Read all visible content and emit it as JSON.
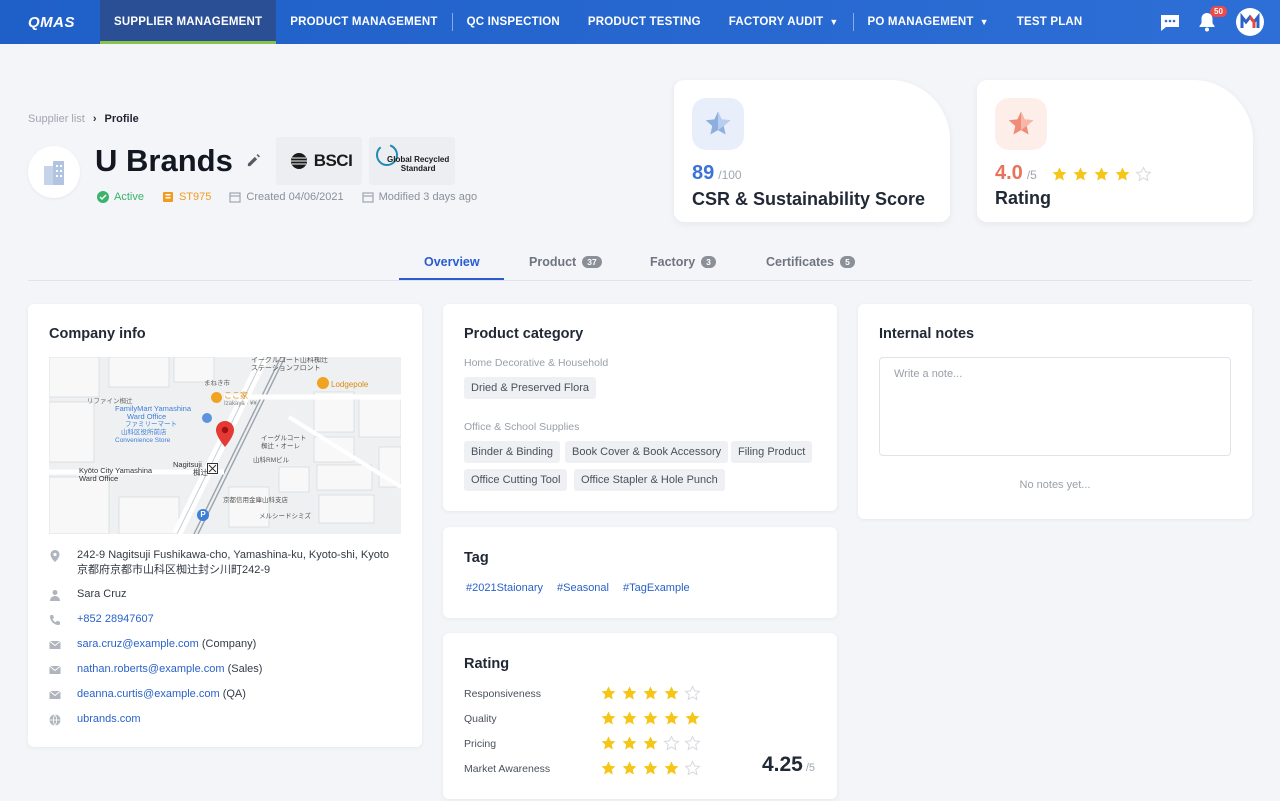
{
  "app": {
    "logo": "QMAS"
  },
  "nav": {
    "items": [
      {
        "label": "SUPPLIER MANAGEMENT"
      },
      {
        "label": "PRODUCT MANAGEMENT"
      },
      {
        "label": "QC INSPECTION"
      },
      {
        "label": "PRODUCT TESTING"
      },
      {
        "label": "FACTORY AUDIT"
      },
      {
        "label": "PO MANAGEMENT"
      },
      {
        "label": "TEST PLAN"
      }
    ],
    "notification_count": "50",
    "colors": {
      "bar": "#2d6fd6",
      "active": "#2b4f94",
      "active_underline": "#8bc34a"
    }
  },
  "breadcrumb": {
    "parent": "Supplier list",
    "current": "Profile"
  },
  "supplier": {
    "name": "U Brands",
    "status": "Active",
    "code": "ST975",
    "created": "Created 04/06/2021",
    "modified": "Modified 3 days ago",
    "certs": [
      {
        "name": "BSCI",
        "text": "BSCI"
      },
      {
        "name": "global-recycled-standard",
        "line1": "Global Recycled",
        "line2": "Standard"
      }
    ]
  },
  "scores": {
    "csr": {
      "value": "89",
      "max": "/100",
      "label": "CSR & Sustainability Score"
    },
    "rating": {
      "value": "4.0",
      "max": "/5",
      "label": "Rating",
      "stars": 4
    }
  },
  "tabs": [
    {
      "label": "Overview",
      "count": ""
    },
    {
      "label": "Product",
      "count": "37"
    },
    {
      "label": "Factory",
      "count": "3"
    },
    {
      "label": "Certificates",
      "count": "5"
    }
  ],
  "company_info": {
    "title": "Company info",
    "map": {
      "labels": {
        "top": "イーグルコート山科椥辻",
        "top2": "ステーションフロント",
        "lodgepole": "Lodgepole",
        "familymart": "FamilyMart Yamashina",
        "ward_office": "Ward Office",
        "jp_familymart": "ファミリーマート",
        "jp_ward": "山科区役所前店",
        "convenience": "Convenience Store",
        "kokoya": "ここ家",
        "izakaya": "Izakaya · ¥¥",
        "kyoto_city": "Kyōto City Yamashina",
        "kyoto_ward": "Ward Office",
        "nagitsuji": "Nagitsuji",
        "nagitsuji_jp": "椥辻",
        "eagle": "イーグルコート",
        "eagle2": "椥辻・オーレ",
        "building": "山科RMビル",
        "bank": "京都信用金庫山科支店",
        "mercedes": "メルシードシミズ",
        "rifine": "リファイン椥辻",
        "manezuki": "まねき市"
      }
    },
    "address_en": "242-9 Nagitsuji Fushikawa-cho, Yamashina-ku, Kyoto-shi, Kyoto",
    "address_jp": "京都府京都市山科区椥辻封シ川町242-9",
    "contact": "Sara Cruz",
    "phone": "+852 28947607",
    "emails": [
      {
        "email": "sara.cruz@example.com",
        "role": "(Company)"
      },
      {
        "email": "nathan.roberts@example.com",
        "role": "(Sales)"
      },
      {
        "email": "deanna.curtis@example.com",
        "role": "(QA)"
      }
    ],
    "website": "ubrands.com"
  },
  "product_category": {
    "title": "Product category",
    "groups": [
      {
        "name": "Home Decorative & Household",
        "items": [
          "Dried & Preserved Flora"
        ]
      },
      {
        "name": "Office & School Supplies",
        "items": [
          "Binder & Binding",
          "Book Cover & Book Accessory",
          "Filing Product",
          "Office Cutting Tool",
          "Office Stapler & Hole Punch"
        ]
      }
    ]
  },
  "tag": {
    "title": "Tag",
    "items": [
      "#2021Staionary",
      "#Seasonal",
      "#TagExample"
    ]
  },
  "rating": {
    "title": "Rating",
    "rows": [
      {
        "label": "Responsiveness",
        "stars": 4
      },
      {
        "label": "Quality",
        "stars": 5
      },
      {
        "label": "Pricing",
        "stars": 3
      },
      {
        "label": "Market Awareness",
        "stars": 4
      }
    ],
    "overall": "4.25",
    "overall_max": "/5"
  },
  "notes": {
    "title": "Internal notes",
    "placeholder": "Write a note...",
    "empty": "No notes yet..."
  },
  "colors": {
    "primary": "#2a5bd0",
    "link": "#2a62c8",
    "star": "#f5c518",
    "active": "#3bb36b",
    "code": "#f29b20",
    "csr": "#3a72d8",
    "rating": "#e8735a"
  }
}
